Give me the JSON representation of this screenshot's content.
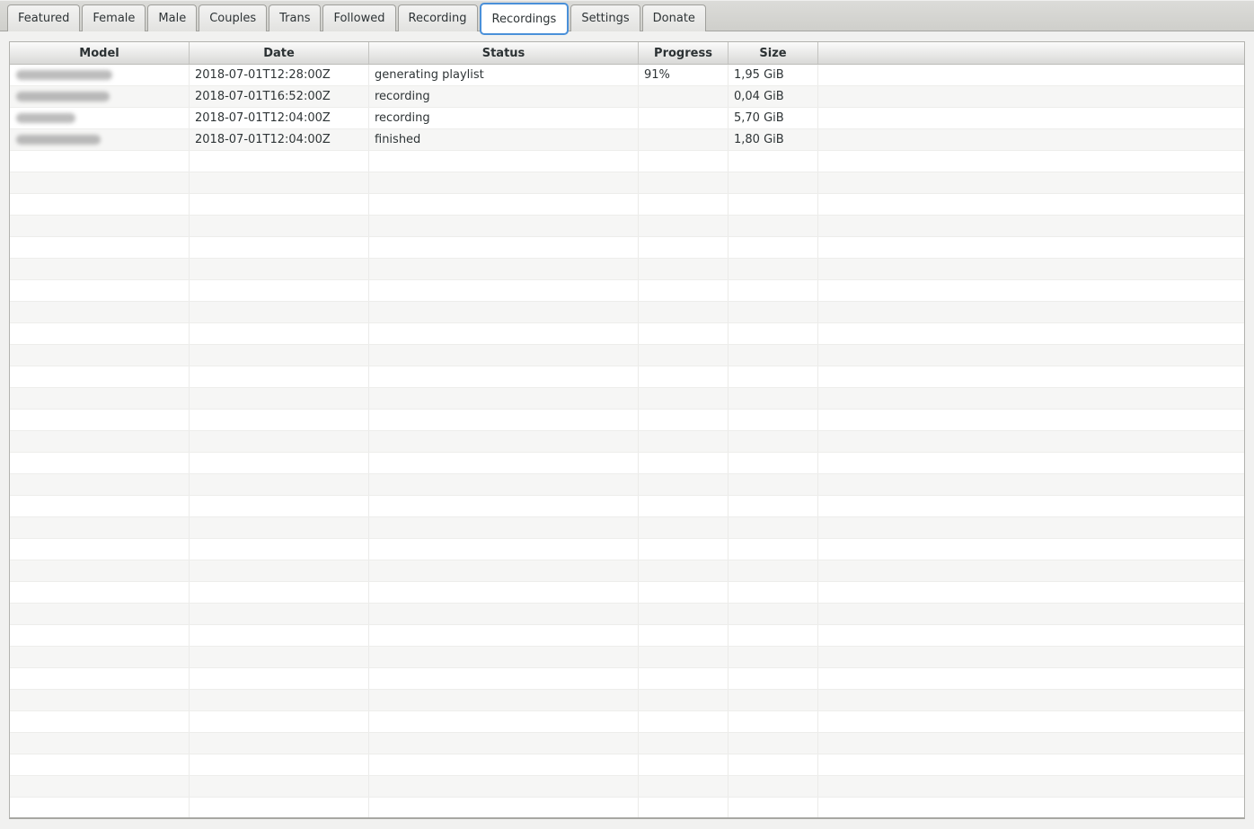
{
  "tabs": {
    "items": [
      {
        "label": "Featured",
        "active": false
      },
      {
        "label": "Female",
        "active": false
      },
      {
        "label": "Male",
        "active": false
      },
      {
        "label": "Couples",
        "active": false
      },
      {
        "label": "Trans",
        "active": false
      },
      {
        "label": "Followed",
        "active": false
      },
      {
        "label": "Recording",
        "active": false
      },
      {
        "label": "Recordings",
        "active": true
      },
      {
        "label": "Settings",
        "active": false
      },
      {
        "label": "Donate",
        "active": false
      }
    ]
  },
  "table": {
    "columns": [
      "Model",
      "Date",
      "Status",
      "Progress",
      "Size",
      ""
    ],
    "rows": [
      {
        "model_redacted": true,
        "model_blur_width": 107,
        "date": "2018-07-01T12:28:00Z",
        "status": "generating playlist",
        "progress": "91%",
        "size": "1,95 GiB"
      },
      {
        "model_redacted": true,
        "model_blur_width": 104,
        "date": "2018-07-01T16:52:00Z",
        "status": "recording",
        "progress": "",
        "size": "0,04 GiB"
      },
      {
        "model_redacted": true,
        "model_blur_width": 66,
        "date": "2018-07-01T12:04:00Z",
        "status": "recording",
        "progress": "",
        "size": "5,70 GiB"
      },
      {
        "model_redacted": true,
        "model_blur_width": 94,
        "date": "2018-07-01T12:04:00Z",
        "status": "finished",
        "progress": "",
        "size": "1,80 GiB"
      }
    ],
    "empty_row_count": 31
  },
  "colors": {
    "active_tab_outline": "#4a90d9",
    "row_stripe": "#f6f6f5",
    "text": "#2e3436"
  }
}
